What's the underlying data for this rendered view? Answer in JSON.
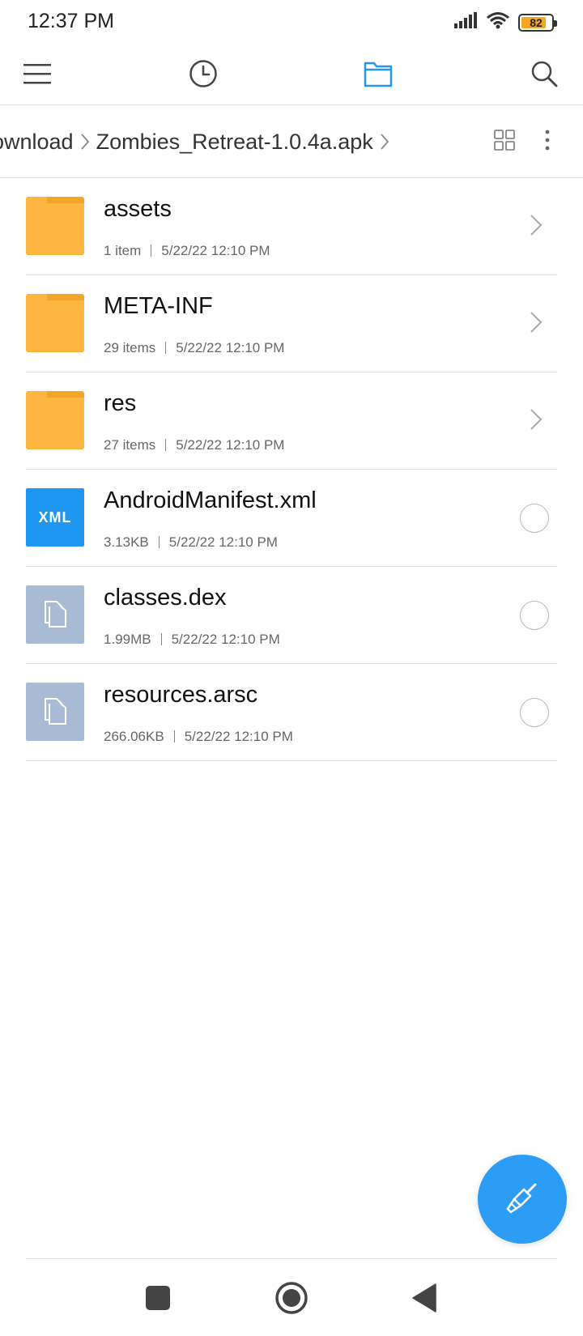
{
  "status_bar": {
    "time": "12:37 PM",
    "battery": "82",
    "battery_level": 0.82
  },
  "toolbar": {
    "menu_icon": "menu-icon",
    "recent_icon": "clock-icon",
    "files_icon": "folder-icon",
    "search_icon": "search-icon",
    "active_color": "#2196f3"
  },
  "breadcrumb": {
    "items": [
      "ownload",
      "Zombies_Retreat-1.0.4a.apk"
    ]
  },
  "files": [
    {
      "name": "assets",
      "count": "1 item",
      "date": "5/22/22 12:10 PM",
      "type": "folder"
    },
    {
      "name": "META-INF",
      "count": "29 items",
      "date": "5/22/22 12:10 PM",
      "type": "folder"
    },
    {
      "name": "res",
      "count": "27 items",
      "date": "5/22/22 12:10 PM",
      "type": "folder"
    },
    {
      "name": "AndroidManifest.xml",
      "size": "3.13KB",
      "date": "5/22/22 12:10 PM",
      "type": "xml",
      "icon_label": "XML"
    },
    {
      "name": "classes.dex",
      "size": "1.99MB",
      "date": "5/22/22 12:10 PM",
      "type": "file"
    },
    {
      "name": "resources.arsc",
      "size": "266.06KB",
      "date": "5/22/22 12:10 PM",
      "type": "file"
    }
  ],
  "colors": {
    "folder": "#fbb540",
    "xml": "#1e97f3",
    "generic_file": "#a7bbd4",
    "fab": "#2d9cf4"
  }
}
